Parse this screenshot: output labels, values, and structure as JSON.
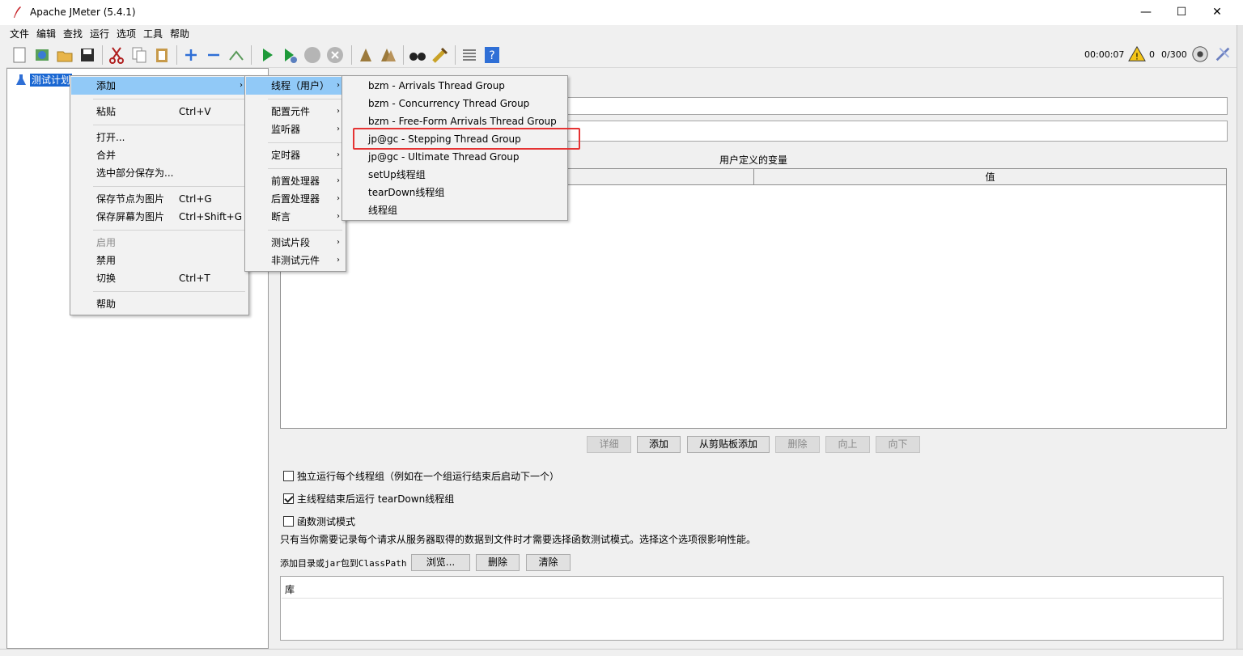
{
  "window": {
    "title": "Apache JMeter (5.4.1)",
    "minimize": "—",
    "maximize": "☐",
    "close": "✕"
  },
  "menubar": [
    "文件",
    "编辑",
    "查找",
    "运行",
    "选项",
    "工具",
    "帮助"
  ],
  "toolbar": {
    "timer": "00:00:07",
    "warnings": "0",
    "threads": "0/300"
  },
  "tree": {
    "root_label": "测试计划"
  },
  "main": {
    "vars_title": "用户定义的变量",
    "vars_columns": [
      "",
      "值"
    ],
    "buttons": {
      "detail": "详细",
      "add": "添加",
      "add_clipboard": "从剪贴板添加",
      "delete": "删除",
      "up": "向上",
      "down": "向下"
    },
    "options": [
      {
        "label": "独立运行每个线程组（例如在一个组运行结束后启动下一个）",
        "checked": false
      },
      {
        "label": "主线程结束后运行 tearDown线程组",
        "checked": true
      },
      {
        "label": "函数测试模式",
        "checked": false
      }
    ],
    "note": "只有当你需要记录每个请求从服务器取得的数据到文件时才需要选择函数测试模式。选择这个选项很影响性能。",
    "classpath_label": "添加目录或jar包到ClassPath",
    "classpath_buttons": {
      "browse": "浏览...",
      "delete": "删除",
      "clear": "清除"
    },
    "lib_header": "库"
  },
  "context_menu": {
    "items": [
      {
        "label": "添加",
        "shortcut": "",
        "submenu": true
      },
      {
        "label": "粘贴",
        "shortcut": "Ctrl+V"
      },
      {
        "label": "打开...",
        "shortcut": ""
      },
      {
        "label": "合并",
        "shortcut": ""
      },
      {
        "label": "选中部分保存为...",
        "shortcut": ""
      },
      {
        "label": "保存节点为图片",
        "shortcut": "Ctrl+G"
      },
      {
        "label": "保存屏幕为图片",
        "shortcut": "Ctrl+Shift+G"
      },
      {
        "label": "启用",
        "shortcut": "",
        "disabled": true
      },
      {
        "label": "禁用",
        "shortcut": ""
      },
      {
        "label": "切换",
        "shortcut": "Ctrl+T"
      },
      {
        "label": "帮助",
        "shortcut": ""
      }
    ]
  },
  "submenu_add": {
    "items": [
      "线程（用户）",
      "配置元件",
      "监听器",
      "定时器",
      "前置处理器",
      "后置处理器",
      "断言",
      "测试片段",
      "非测试元件"
    ]
  },
  "submenu_threads": {
    "items": [
      "bzm - Arrivals Thread Group",
      "bzm - Concurrency Thread Group",
      "bzm - Free-Form Arrivals Thread Group",
      "jp@gc - Stepping Thread Group",
      "jp@gc - Ultimate Thread Group",
      "setUp线程组",
      "tearDown线程组",
      "线程组"
    ]
  },
  "colors": {
    "selection": "#1a67d2",
    "menu_highlight": "#91c9f7",
    "annotation": "#e53333"
  }
}
